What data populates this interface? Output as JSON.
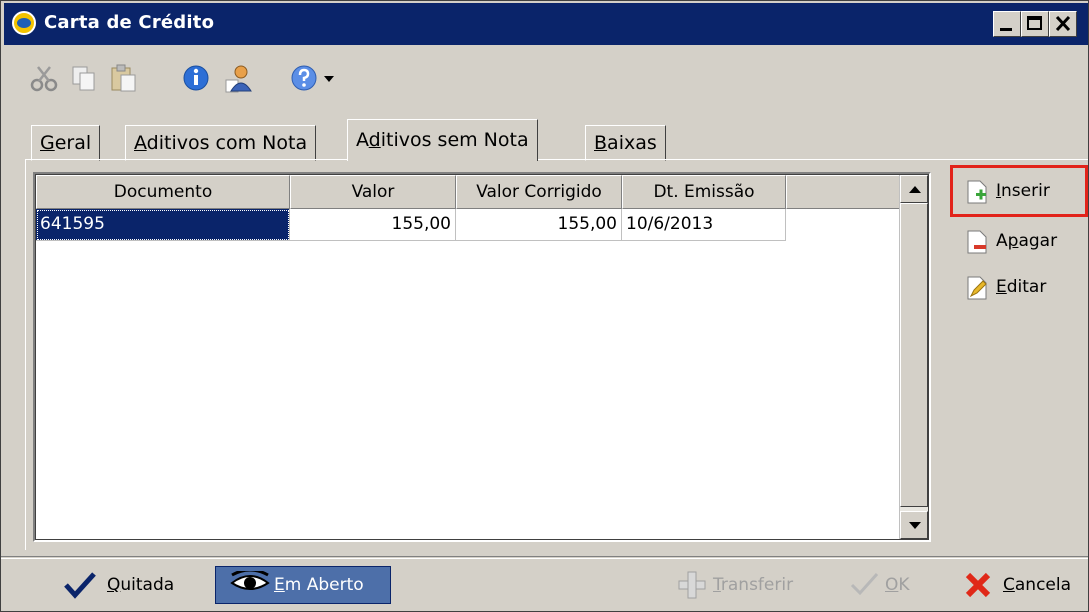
{
  "window": {
    "title": "Carta de Crédito",
    "controls": {
      "minimize": "_",
      "maximize": "□",
      "close": "×"
    }
  },
  "toolbar": {
    "icons": [
      "scissors-icon",
      "copy-icon",
      "paste-icon",
      "info-icon",
      "user-icon",
      "help-icon",
      "dropdown-arrow-icon"
    ]
  },
  "tabs": [
    {
      "label": "Geral",
      "mnemonic": "G",
      "rest": "eral"
    },
    {
      "label": "Aditivos com Nota",
      "mnemonic": "A",
      "rest": "ditivos com Nota"
    },
    {
      "label": "Aditivos sem Nota",
      "pre": "A",
      "mnemonic": "d",
      "rest": "itivos sem Nota",
      "active": true
    },
    {
      "label": "Baixas",
      "mnemonic": "B",
      "rest": "aixas"
    }
  ],
  "grid": {
    "columns": [
      "Documento",
      "Valor",
      "Valor Corrigido",
      "Dt. Emissão"
    ],
    "rows": [
      {
        "documento": "641595",
        "valor": "155,00",
        "valor_corrigido": "155,00",
        "dt_emissao": "10/6/2013"
      }
    ]
  },
  "side_actions": {
    "inserir": {
      "mnemonic": "I",
      "rest": "nserir"
    },
    "apagar": {
      "pre": "A",
      "mnemonic": "p",
      "rest": "agar"
    },
    "editar": {
      "mnemonic": "E",
      "rest": "ditar"
    }
  },
  "statusbar": {
    "quitada": {
      "mnemonic": "Q",
      "rest": "uitada"
    },
    "em_aberto": {
      "mnemonic": "E",
      "rest": "m Aberto"
    },
    "transferir": {
      "mnemonic": "T",
      "rest": "ransferir"
    },
    "ok": {
      "mnemonic": "O",
      "rest": "K"
    },
    "cancela": {
      "mnemonic": "C",
      "rest": "ancela"
    }
  },
  "colors": {
    "titlebar": "#0a246a",
    "selection": "#0a246a",
    "highlight_box": "#e2231a",
    "face": "#d4d0c8"
  }
}
